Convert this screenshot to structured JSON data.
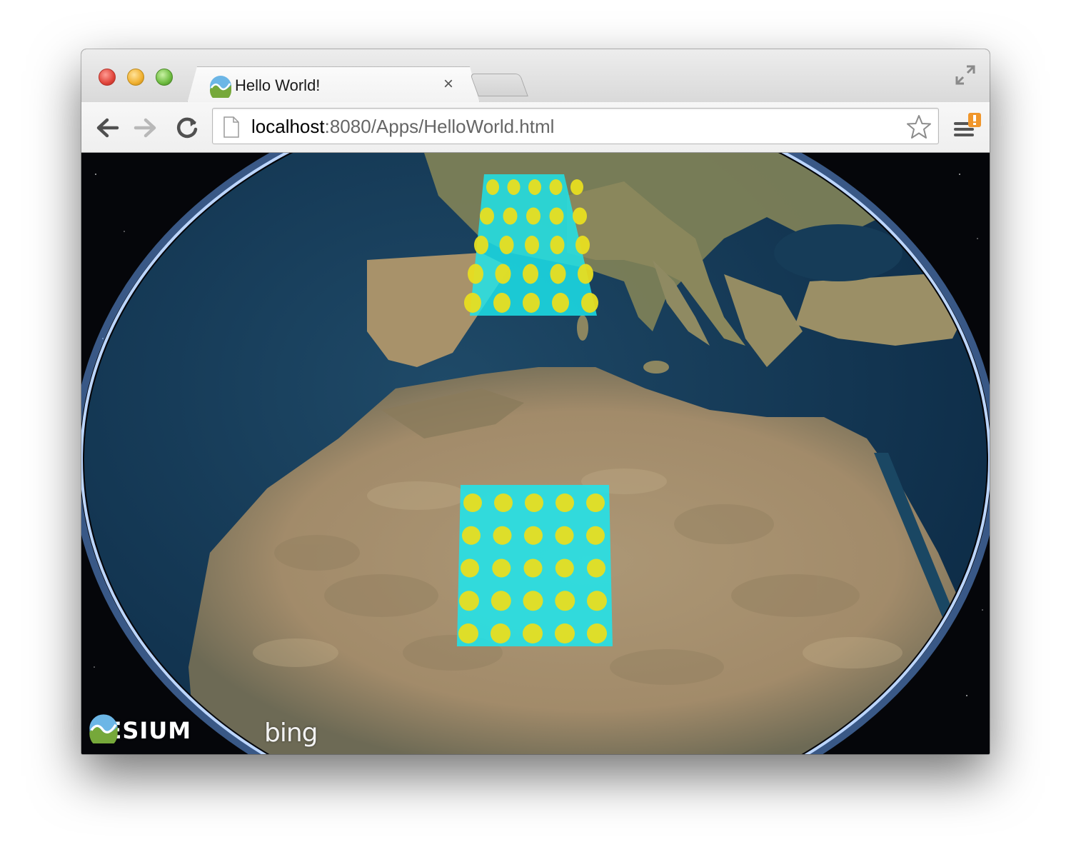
{
  "window": {
    "tab": {
      "title": "Hello World!",
      "close_glyph": "×",
      "favicon": "cesium-icon"
    }
  },
  "toolbar": {
    "url_host": "localhost",
    "url_rest": ":8080/Apps/HelloWorld.html",
    "icons": [
      "back-icon",
      "forward-icon",
      "reload-icon",
      "page-icon",
      "star-icon",
      "menu-icon"
    ]
  },
  "viewer": {
    "logo_text": "CESIUM",
    "imagery_credit": "bing",
    "grids": [
      {
        "name": "upper",
        "rows": 5,
        "cols": 5
      },
      {
        "name": "lower",
        "rows": 5,
        "cols": 5
      }
    ],
    "colors": {
      "rectangle": "#1ce6ee",
      "dot": "#e8de20",
      "ocean": "#173b57",
      "land": "#a99572"
    }
  }
}
